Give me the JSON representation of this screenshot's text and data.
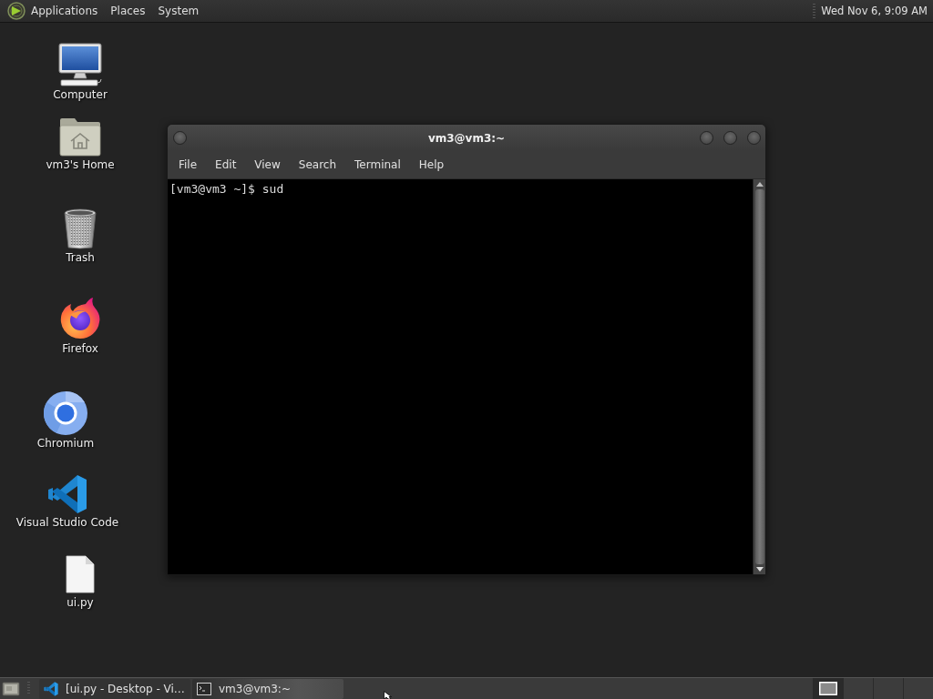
{
  "top_panel": {
    "menus": [
      "Applications",
      "Places",
      "System"
    ],
    "clock": "Wed Nov 6, 9:09 AM"
  },
  "desktop_icons": [
    {
      "kind": "computer",
      "label": "Computer"
    },
    {
      "kind": "home",
      "label": "vm3's Home"
    },
    {
      "kind": "trash",
      "label": "Trash"
    },
    {
      "kind": "firefox",
      "label": "Firefox"
    },
    {
      "kind": "chromium",
      "label": "Chromium"
    },
    {
      "kind": "vscode",
      "label": "Visual Studio Code"
    },
    {
      "kind": "file",
      "label": "ui.py"
    }
  ],
  "terminal_window": {
    "title": "vm3@vm3:~",
    "menu": [
      "File",
      "Edit",
      "View",
      "Search",
      "Terminal",
      "Help"
    ],
    "lines": [
      "[vm3@vm3 ~]$ sud"
    ]
  },
  "bottom_panel": {
    "tasks": [
      {
        "kind": "vscode",
        "label": "[ui.py - Desktop - Vi…",
        "selected": false
      },
      {
        "kind": "terminal",
        "label": "vm3@vm3:~",
        "selected": true
      }
    ],
    "workspaces": [
      {
        "selected": true,
        "has_window": true
      },
      {
        "selected": false,
        "has_window": false
      },
      {
        "selected": false,
        "has_window": false
      },
      {
        "selected": false,
        "has_window": false
      }
    ]
  }
}
